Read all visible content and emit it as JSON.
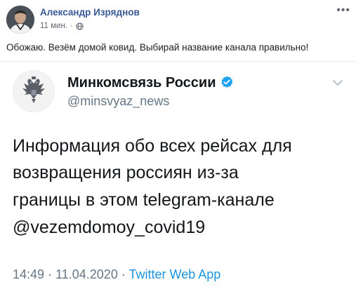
{
  "post": {
    "author": "Александр Изряднов",
    "time": "11 мин.",
    "separator": "·",
    "text": "Обожаю. Везём домой ковид. Выбирай название канала правильно!",
    "more_icon": "ellipsis-icon",
    "privacy_icon": "globe-icon"
  },
  "tweet": {
    "name": "Минкомсвязь России",
    "handle": "@minsvyaz_news",
    "lines": [
      "Информация обо всех рейсах для",
      "возвращения россиян из-за",
      "границы в этом telegram-канале",
      "@vezemdomoy_covid19"
    ],
    "time": "14:49",
    "sep1": "·",
    "date": "11.04.2020",
    "sep2": "·",
    "app": "Twitter Web App",
    "verified_color": "#1da1f2"
  }
}
